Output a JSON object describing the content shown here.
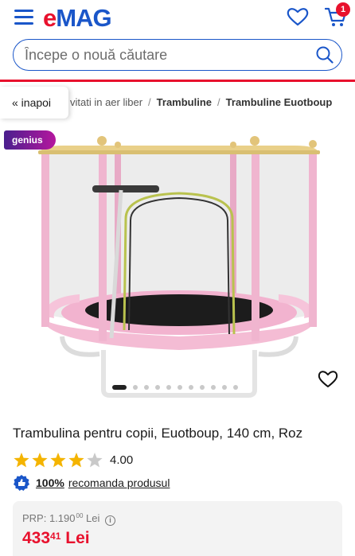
{
  "header": {
    "logo_e": "e",
    "logo_mag": "MAG",
    "cart_count": "1",
    "brand_red": "#e8112d",
    "brand_blue": "#1a56c9"
  },
  "search": {
    "placeholder": "Începe o nouă căutare"
  },
  "breadcrumb": {
    "back_label": "« inapoi",
    "items": [
      "vitati in aer liber",
      "Trambuline",
      "Trambuline Euotboup"
    ],
    "separator": "/"
  },
  "badge": {
    "genius": "genius"
  },
  "gallery": {
    "image_count": 11,
    "active_index": 0
  },
  "product": {
    "title": "Trambulina pentru copii, Euotboup, 140 cm, Roz",
    "rating": "4.00",
    "rating_stars": 4,
    "rating_max": 5,
    "recommend_pct": "100%",
    "recommend_text": "recomanda produsul"
  },
  "price": {
    "prp_label": "PRP: 1.190",
    "prp_decimals": "00",
    "prp_currency": "Lei",
    "current_int": "433",
    "current_dec": "41",
    "current_currency": "Lei"
  }
}
